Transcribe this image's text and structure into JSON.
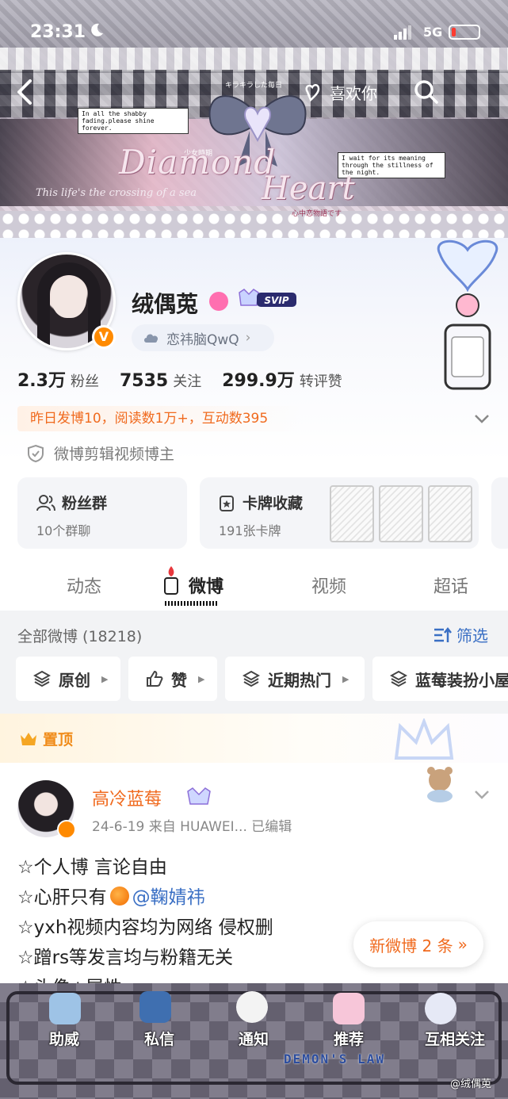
{
  "status_bar": {
    "time": "23:31",
    "network": "5G"
  },
  "banner": {
    "title_1": "Diamond",
    "title_2": "Heart",
    "note_1": "In all the shabby fading.please shine forever.",
    "note_2": "I wait for its meaning through the stillness of the night.",
    "jp_top": "キラキラした毎日",
    "jp_small": "少女時期",
    "jp_bottom": "心中恋物語です",
    "italic_line": "This life's the crossing of a sea"
  },
  "topbar": {
    "like_label": "喜欢你"
  },
  "profile": {
    "username": "绒偶莵",
    "vip_label": "SVIP",
    "tag": "恋祎脑QwQ",
    "stats": [
      {
        "num": "2.3万",
        "label": "粉丝"
      },
      {
        "num": "7535",
        "label": "关注"
      },
      {
        "num": "299.9万",
        "label": "转评赞"
      }
    ],
    "activity": "昨日发博10，阅读数1万+，互动数395",
    "role": "微博剪辑视频博主"
  },
  "cards": {
    "fans_group": {
      "title": "粉丝群",
      "sub": "10个群聊"
    },
    "card_collection": {
      "title": "卡牌收藏",
      "sub": "191张卡牌"
    }
  },
  "tabs": [
    "动态",
    "微博",
    "视频",
    "超话"
  ],
  "filter": {
    "all_label": "全部微博 (18218)",
    "screen_label": "筛选",
    "chips": [
      "原创",
      "赞",
      "近期热门",
      "蓝莓装扮小屋"
    ]
  },
  "pinned": {
    "label": "置顶"
  },
  "post": {
    "author": "高冷蓝莓",
    "meta": "24-6-19  来自 HUAWEI...  已编辑",
    "line1": "☆个人博 言论自由",
    "line2_prefix": "☆心肝只有",
    "line2_mention": "@鞠婧祎",
    "line3": "☆yxh视频内容均为网络 侵权删",
    "line4": "☆蹭rs等发言均与粉籍无关",
    "line5": "☆头像+属性"
  },
  "new_weibo": "新微博 2 条",
  "bottom_nav": [
    "助威",
    "私信",
    "通知",
    "推荐",
    "互相关注"
  ],
  "bottom_text": "DEMON'S LAW",
  "watermark": "@绒偶莵",
  "colors": {
    "accent_orange": "#f06a1e",
    "link_blue": "#3a6fc4"
  }
}
